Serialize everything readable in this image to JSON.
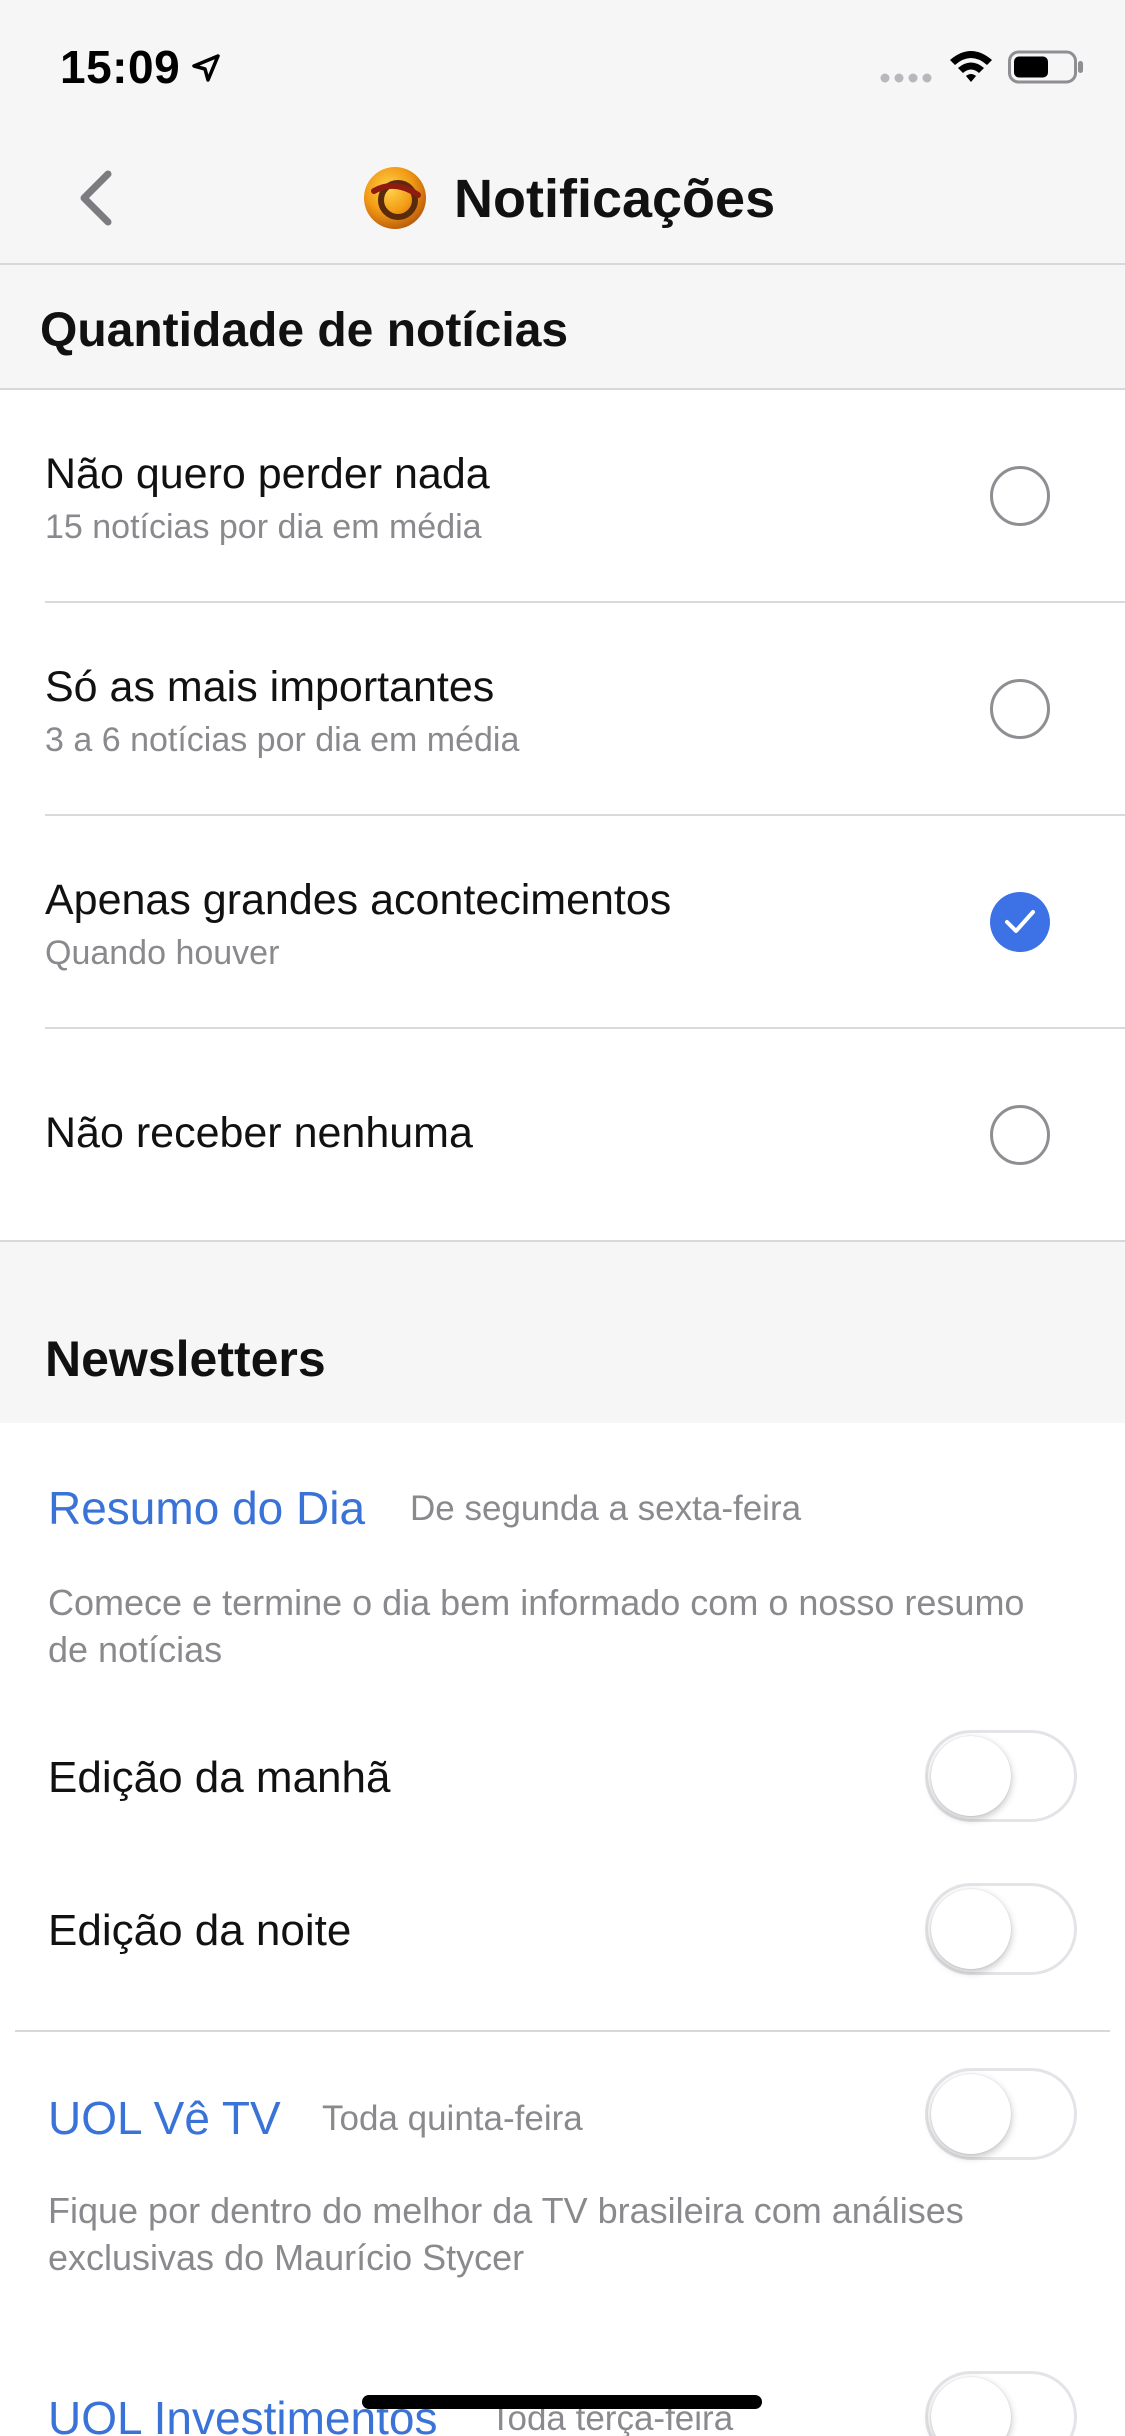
{
  "status_bar": {
    "time": "15:09",
    "icons": [
      "location-arrow-icon",
      "signal-icon",
      "wifi-icon",
      "battery-icon"
    ]
  },
  "nav": {
    "title": "Notificações",
    "back_icon": "chevron-left-icon",
    "logo": "uol-logo-icon"
  },
  "quantity_section": {
    "header": "Quantidade de notícias",
    "options": [
      {
        "title": "Não quero perder nada",
        "subtitle": "15 notícias por dia em média",
        "selected": false
      },
      {
        "title": "Só as mais importantes",
        "subtitle": "3 a 6 notícias por dia em média",
        "selected": false
      },
      {
        "title": "Apenas grandes acontecimentos",
        "subtitle": "Quando houver",
        "selected": true
      },
      {
        "title": "Não receber nenhuma",
        "subtitle": "",
        "selected": false
      }
    ]
  },
  "newsletters": {
    "header": "Newsletters",
    "items": [
      {
        "name": "Resumo do Dia",
        "frequency": "De segunda a sexta-feira",
        "description": "Comece e termine o dia bem informado com o nosso resumo de notícias",
        "editions": [
          {
            "label": "Edição da manhã",
            "enabled": false
          },
          {
            "label": "Edição da noite",
            "enabled": false
          }
        ]
      },
      {
        "name": "UOL Vê TV",
        "frequency": "Toda quinta-feira",
        "description": "Fique por dentro do melhor da TV brasileira com análises exclusivas do Maurício Stycer",
        "enabled": false
      },
      {
        "name": "UOL Investimentos",
        "frequency": "Toda terça-feira",
        "enabled": false
      }
    ]
  },
  "colors": {
    "accent": "#3d71e6",
    "link": "#3a73d8",
    "secondary_text": "#8a8a8e",
    "grouped_background": "#f6f6f7"
  }
}
